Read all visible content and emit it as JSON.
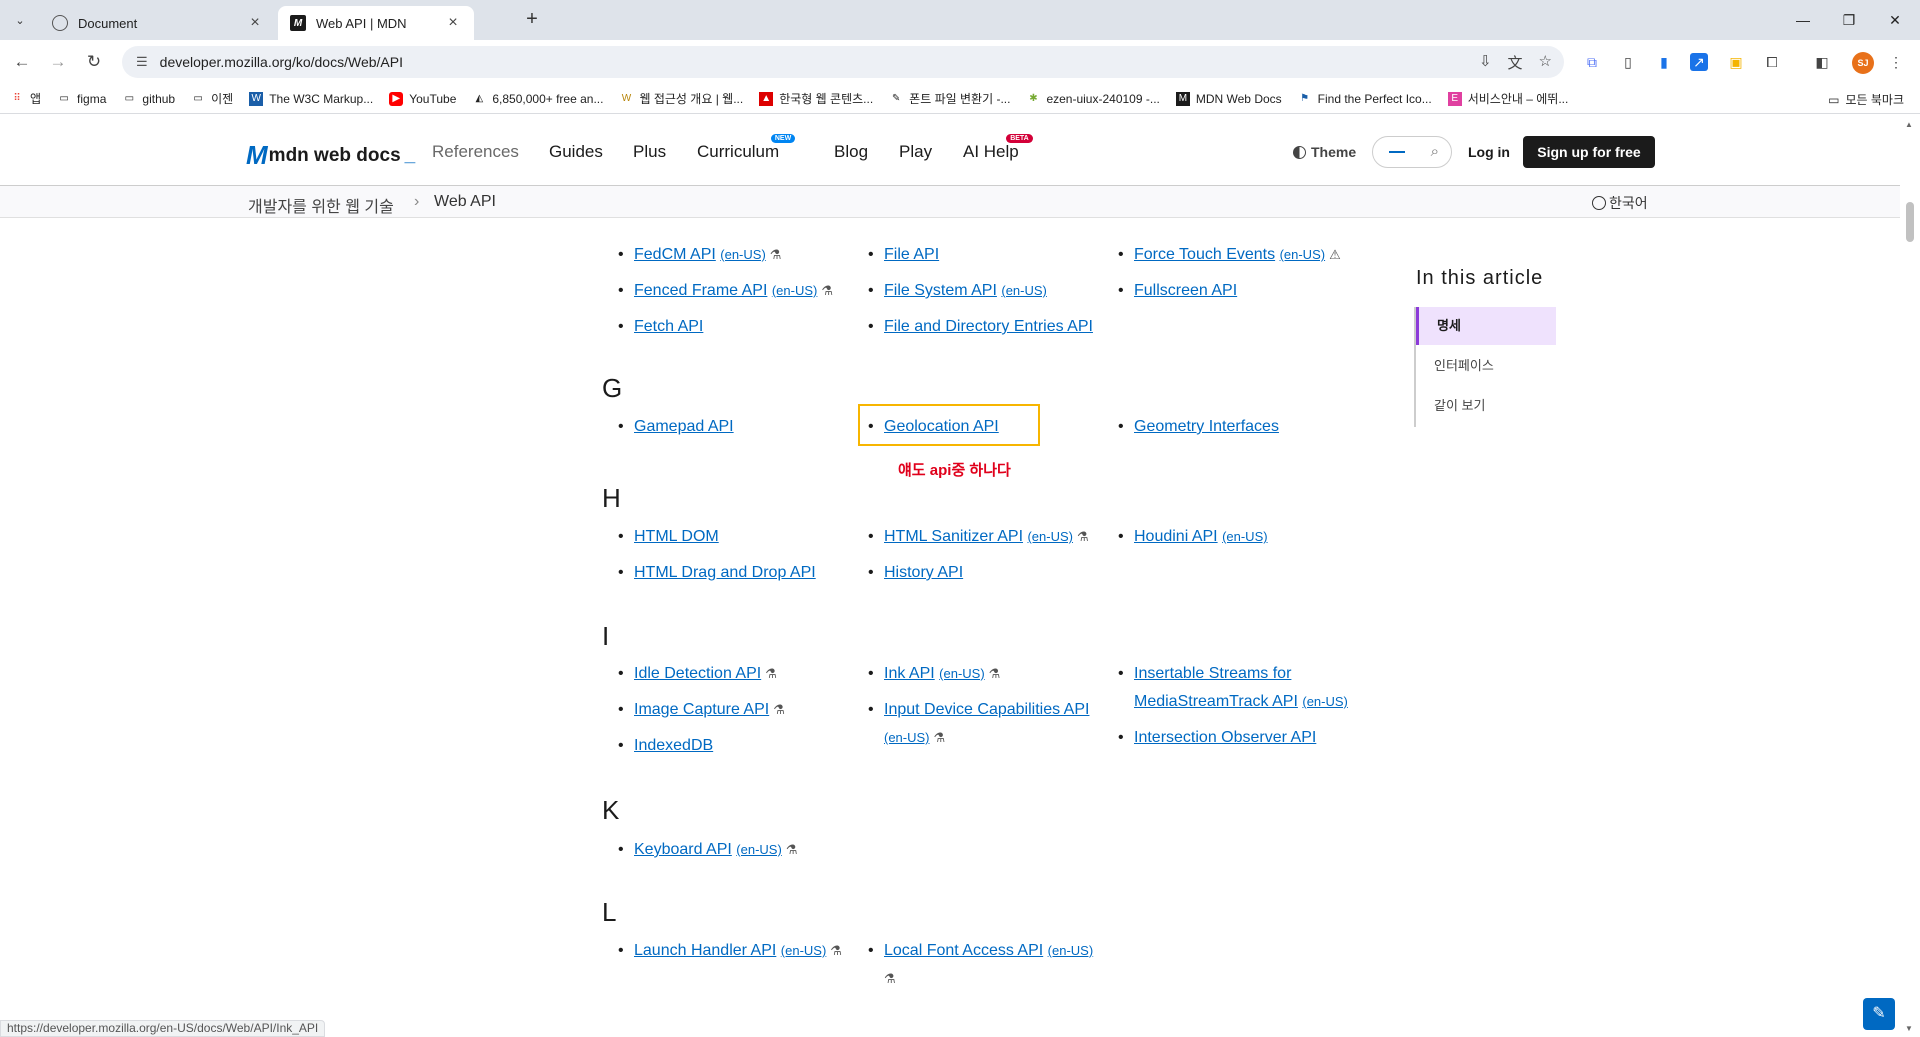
{
  "browser": {
    "tabs": [
      {
        "title": "Document",
        "icon": "globe-icon"
      },
      {
        "title": "Web API | MDN",
        "icon": "mdn-icon"
      }
    ],
    "url": "developer.mozilla.org/ko/docs/Web/API",
    "avatar": "SJ",
    "status_url": "https://developer.mozilla.org/en-US/docs/Web/API/Ink_API",
    "bookmarks": [
      "앱",
      "figma",
      "github",
      "이젠",
      "The W3C Markup...",
      "YouTube",
      "6,850,000+ free an...",
      "웹 접근성 개요 | 웹...",
      "한국형 웹 콘텐츠...",
      "폰트 파일 변환기 -...",
      "ezen-uiux-240109 -...",
      "MDN Web Docs",
      "Find the Perfect Ico...",
      "서비스안내 – 에뛰..."
    ],
    "bookmarks_right": "모든 북마크"
  },
  "mdn": {
    "logo": "mdn web docs",
    "nav": [
      "References",
      "Guides",
      "Plus",
      "Curriculum",
      "Blog",
      "Play",
      "AI Help"
    ],
    "badge_new": "NEW",
    "badge_beta": "BETA",
    "theme": "Theme",
    "login": "Log in",
    "signup": "Sign up for free",
    "breadcrumb": [
      "개발자를 위한 웹 기술",
      "Web API"
    ],
    "language": "한국어"
  },
  "content": {
    "en_tag": "(en-US)",
    "sections": {
      "G": "G",
      "H": "H",
      "I": "I",
      "K": "K",
      "L": "L"
    },
    "items": {
      "fedcm": "FedCM API",
      "fenced": "Fenced Frame API",
      "fetch": "Fetch API",
      "fileapi": "File API",
      "filesystem": "File System API",
      "filedir": "File and Directory Entries API",
      "forcetouch": "Force Touch Events",
      "fullscreen": "Fullscreen API",
      "gamepad": "Gamepad API",
      "geolocation": "Geolocation API",
      "geometry": "Geometry Interfaces",
      "htmldom": "HTML DOM",
      "htmldnd": "HTML Drag and Drop API",
      "sanitizer": "HTML Sanitizer API",
      "history": "History API",
      "houdini": "Houdini API",
      "idle": "Idle Detection API",
      "imagecap": "Image Capture API",
      "indexeddb": "IndexedDB",
      "ink": "Ink API",
      "inputdevice": "Input Device Capabilities API",
      "insertable1": "Insertable Streams for",
      "insertable2": "MediaStreamTrack API",
      "intersection": "Intersection Observer API",
      "keyboard": "Keyboard API",
      "launch": "Launch Handler API",
      "localfont": "Local Font Access API"
    },
    "annotation": "얘도 api중 하나다"
  },
  "toc": {
    "title": "In this article",
    "items": [
      "명세",
      "인터페이스",
      "같이 보기"
    ]
  }
}
